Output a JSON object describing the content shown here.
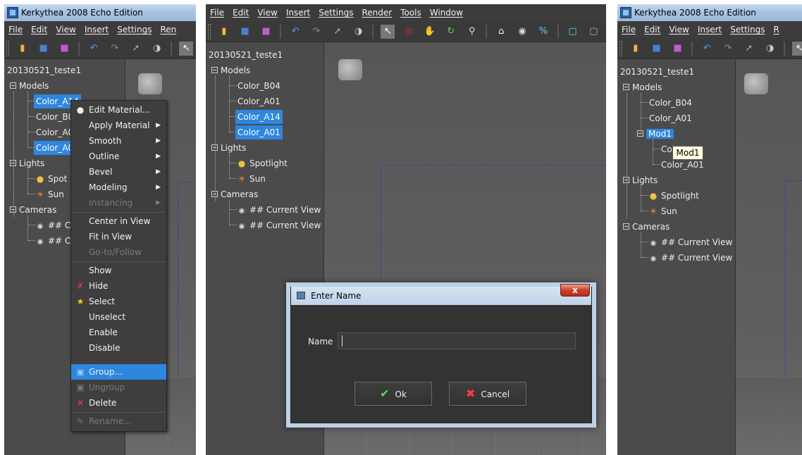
{
  "app_title": "Kerkythea 2008 Echo Edition",
  "menu_full": [
    "File",
    "Edit",
    "View",
    "Insert",
    "Settings",
    "Render",
    "Tools",
    "Window"
  ],
  "menu_short": [
    "File",
    "Edit",
    "View",
    "Insert",
    "Settings",
    "Ren"
  ],
  "menu_short3": [
    "File",
    "Edit",
    "View",
    "Insert",
    "Settings",
    "R"
  ],
  "scene_name": "20130521_teste1",
  "panel1": {
    "models_label": "Models",
    "models": [
      "Color_A14",
      "Color_B0",
      "Color_A0",
      "Color_A0"
    ],
    "lights_label": "Lights",
    "lights": [
      "Spot",
      "Sun"
    ],
    "cameras_label": "Cameras",
    "cameras": [
      "## C",
      "## C"
    ]
  },
  "context_menu": [
    {
      "label": "Edit Material...",
      "icon": "dot-icon",
      "state": "normal"
    },
    {
      "label": "Apply Material",
      "submenu": true,
      "state": "normal"
    },
    {
      "label": "Smooth",
      "submenu": true,
      "state": "normal"
    },
    {
      "label": "Outline",
      "submenu": true,
      "state": "normal"
    },
    {
      "label": "Bevel",
      "submenu": true,
      "state": "normal"
    },
    {
      "label": "Modeling",
      "submenu": true,
      "state": "normal"
    },
    {
      "label": "Instancing",
      "submenu": true,
      "state": "disabled"
    },
    {
      "label": "Center in View",
      "state": "normal"
    },
    {
      "label": "Fit in View",
      "state": "normal"
    },
    {
      "label": "Go-to/Follow",
      "state": "disabled"
    },
    {
      "label": "Show",
      "state": "normal"
    },
    {
      "label": "Hide",
      "icon": "hide-icon",
      "state": "normal"
    },
    {
      "label": "Select",
      "icon": "star-icon",
      "state": "normal"
    },
    {
      "label": "Unselect",
      "state": "normal"
    },
    {
      "label": "Enable",
      "state": "normal"
    },
    {
      "label": "Disable",
      "state": "normal"
    },
    {
      "label": "Group...",
      "icon": "group-icon",
      "state": "highlighted"
    },
    {
      "label": "Ungroup",
      "icon": "ungroup-icon",
      "state": "disabled"
    },
    {
      "label": "Delete",
      "icon": "delete-icon",
      "state": "normal"
    },
    {
      "label": "Rename...",
      "icon": "rename-icon",
      "state": "disabled"
    }
  ],
  "panel2": {
    "models_label": "Models",
    "models": [
      "Color_B04",
      "Color_A01",
      "Color_A14",
      "Color_A01"
    ],
    "lights_label": "Lights",
    "lights": [
      "Spotlight",
      "Sun"
    ],
    "cameras_label": "Cameras",
    "cameras": [
      "## Current View",
      "## Current View"
    ]
  },
  "dialog": {
    "title": "Enter Name",
    "close": "x",
    "name_label": "Name",
    "name_value": "",
    "ok_label": "Ok",
    "cancel_label": "Cancel"
  },
  "panel3": {
    "models_label": "Models",
    "models": [
      "Color_B04",
      "Color_A01"
    ],
    "group_label": "Mod1",
    "group_children": [
      "Color_A14",
      "Color_A01"
    ],
    "lights_label": "Lights",
    "lights": [
      "Spotlight",
      "Sun"
    ],
    "cameras_label": "Cameras",
    "cameras": [
      "## Current View",
      "## Current View"
    ],
    "tooltip": "Mod1"
  },
  "colors": {
    "selection": "#2e86de",
    "background": "#4a4a4a"
  }
}
